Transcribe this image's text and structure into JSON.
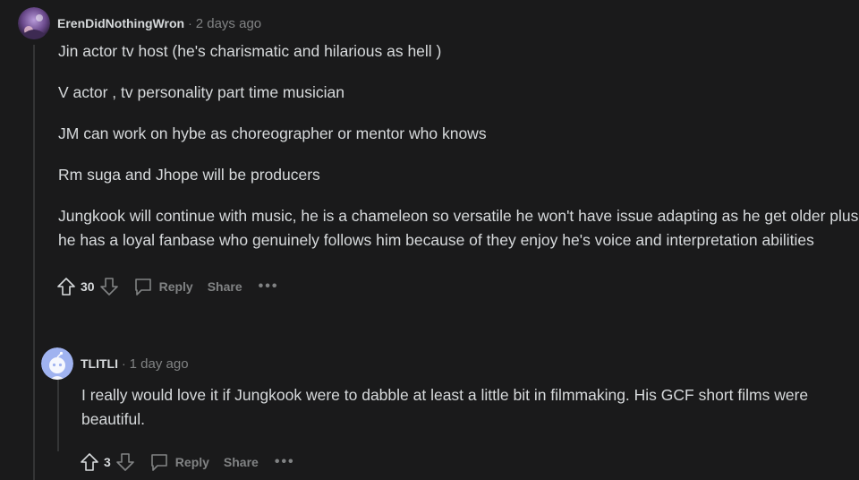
{
  "comment1": {
    "username": "ErenDidNothingWron",
    "separator": "·",
    "time": "2 days ago",
    "paragraphs": [
      "Jin actor tv host (he's charismatic and hilarious as hell )",
      "V actor , tv personality part time musician",
      "JM can work on hybe as choreographer or mentor who knows",
      "Rm suga and Jhope will be producers",
      "Jungkook will continue with music, he is a chameleon so versatile he won't have issue adapting as he get older plus he has a loyal fanbase who genuinely follows him because of they enjoy he's voice and interpretation abilities"
    ],
    "score": "30",
    "reply_label": "Reply",
    "share_label": "Share",
    "more_label": "•••"
  },
  "comment2": {
    "username": "TLITLI",
    "separator": "·",
    "time": "1 day ago",
    "paragraphs": [
      "I really would love it if Jungkook were to dabble at least a little bit in filmmaking. His GCF short films were beautiful."
    ],
    "score": "3",
    "reply_label": "Reply",
    "share_label": "Share",
    "more_label": "•••"
  },
  "colors": {
    "background": "#1a1a1b",
    "text": "#d7dadc",
    "muted": "#818384",
    "default_avatar_bg": "#a0b3f0"
  }
}
